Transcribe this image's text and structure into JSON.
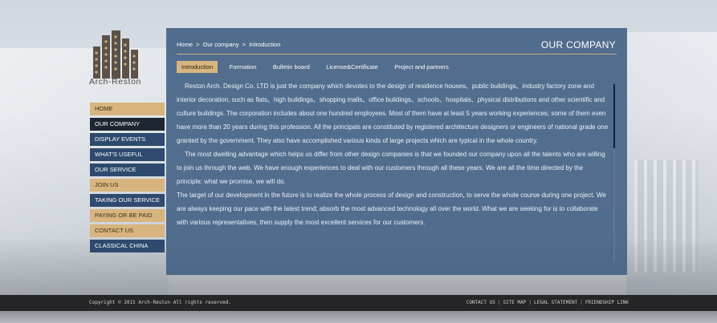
{
  "brand": {
    "name": "Arch-Reston",
    "logo_icon": "building-cluster-icon"
  },
  "nav": {
    "items": [
      {
        "label": "HOME",
        "style": "tan"
      },
      {
        "label": "OUR COMPANY",
        "style": "dark"
      },
      {
        "label": "DISPLAY EVENTS",
        "style": "navy"
      },
      {
        "label": "WHAT'S USEFUL",
        "style": "navy"
      },
      {
        "label": "OUR SERVICE",
        "style": "navy"
      },
      {
        "label": "JOIN US",
        "style": "tan"
      },
      {
        "label": "TAKING OUR SERVICE",
        "style": "navy"
      },
      {
        "label": "PAYING OR BE PAID",
        "style": "tan"
      },
      {
        "label": "CONTACT US",
        "style": "tan"
      },
      {
        "label": "CLASSICAL CHINA",
        "style": "navy"
      }
    ]
  },
  "panel": {
    "breadcrumb": [
      "Home",
      ">",
      "Our company",
      ">",
      "Introduction"
    ],
    "title": "OUR COMPANY",
    "tabs": [
      {
        "label": "Introduction",
        "active": true
      },
      {
        "label": "Formation",
        "active": false
      },
      {
        "label": "Bulletin board",
        "active": false
      },
      {
        "label": "License&Certificate",
        "active": false
      },
      {
        "label": "Project and partners",
        "active": false
      }
    ],
    "paragraphs": [
      "Reston Arch. Design Co. LTD is just the company which devotes to the design of residence houses、public buildings、industry factory zone and interior decoration, such as flats、high buildings、shopping malls、office buildings、schools、hospitals、physical distributions and other scientific and culture buildings. The corporation includes about one hundred employees. Most of them have at least 5 years working experiences; some of them even have more than 20 years during this profession. All the principals are constituted by registered architecture designers or engineers of national grade one granted by the government. They also have accomplished various kinds of large projects which are typical in the whole country.",
      "The most dwelling advantage which helps us differ from other design companies is that we founded our company upon all the talents who are willing to join us through the web. We have enough experiences to deal with our customers through all these years. We are all the time directed by the principle: what we promise, we will do.",
      "The target of our development in the future is to realize the whole process of design and construction, to serve the whole course during one project. We are always keeping our pace with the latest trend; absorb the most advanced technology all over the world. What we are seeking for is to collaborate with various representatives, then supply the most excellent services for our customers."
    ]
  },
  "footer": {
    "copyright": "Copyright © 2015 Arch-Reston All rights reserved.",
    "links": [
      "CONTACT US",
      "SITE MAP",
      "LEGAL STATEMENT",
      "FRIENDSHIP LINK"
    ],
    "separator": "|"
  },
  "colors": {
    "panel_bg": "#3f5d82",
    "accent_tan": "#d8b57e",
    "nav_navy": "#2e4a6e",
    "nav_dark": "#1e2632",
    "footer_bg": "#262628"
  }
}
